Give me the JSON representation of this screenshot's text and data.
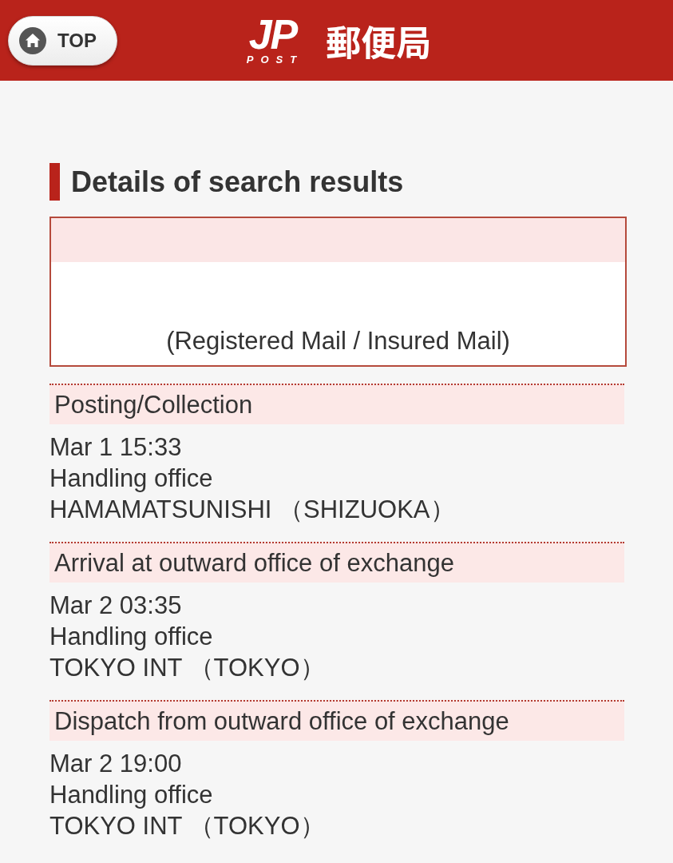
{
  "header": {
    "top_button": {
      "label": "TOP"
    },
    "logo": {
      "mark": "JP",
      "sub": "POST",
      "name": "郵便局"
    }
  },
  "title": "Details of search results",
  "item": {
    "mail_type": "(Registered Mail / Insured Mail)"
  },
  "events": [
    {
      "status": "Posting/Collection",
      "date": "Mar 1 15:33",
      "office_label": "Handling office",
      "office": "HAMAMATSUNISHI （SHIZUOKA）"
    },
    {
      "status": "Arrival at outward office of exchange",
      "date": "Mar 2 03:35",
      "office_label": "Handling office",
      "office": "TOKYO INT （TOKYO）"
    },
    {
      "status": "Dispatch from outward office of exchange",
      "date": "Mar 2 19:00",
      "office_label": "Handling office",
      "office": "TOKYO INT （TOKYO）"
    }
  ]
}
